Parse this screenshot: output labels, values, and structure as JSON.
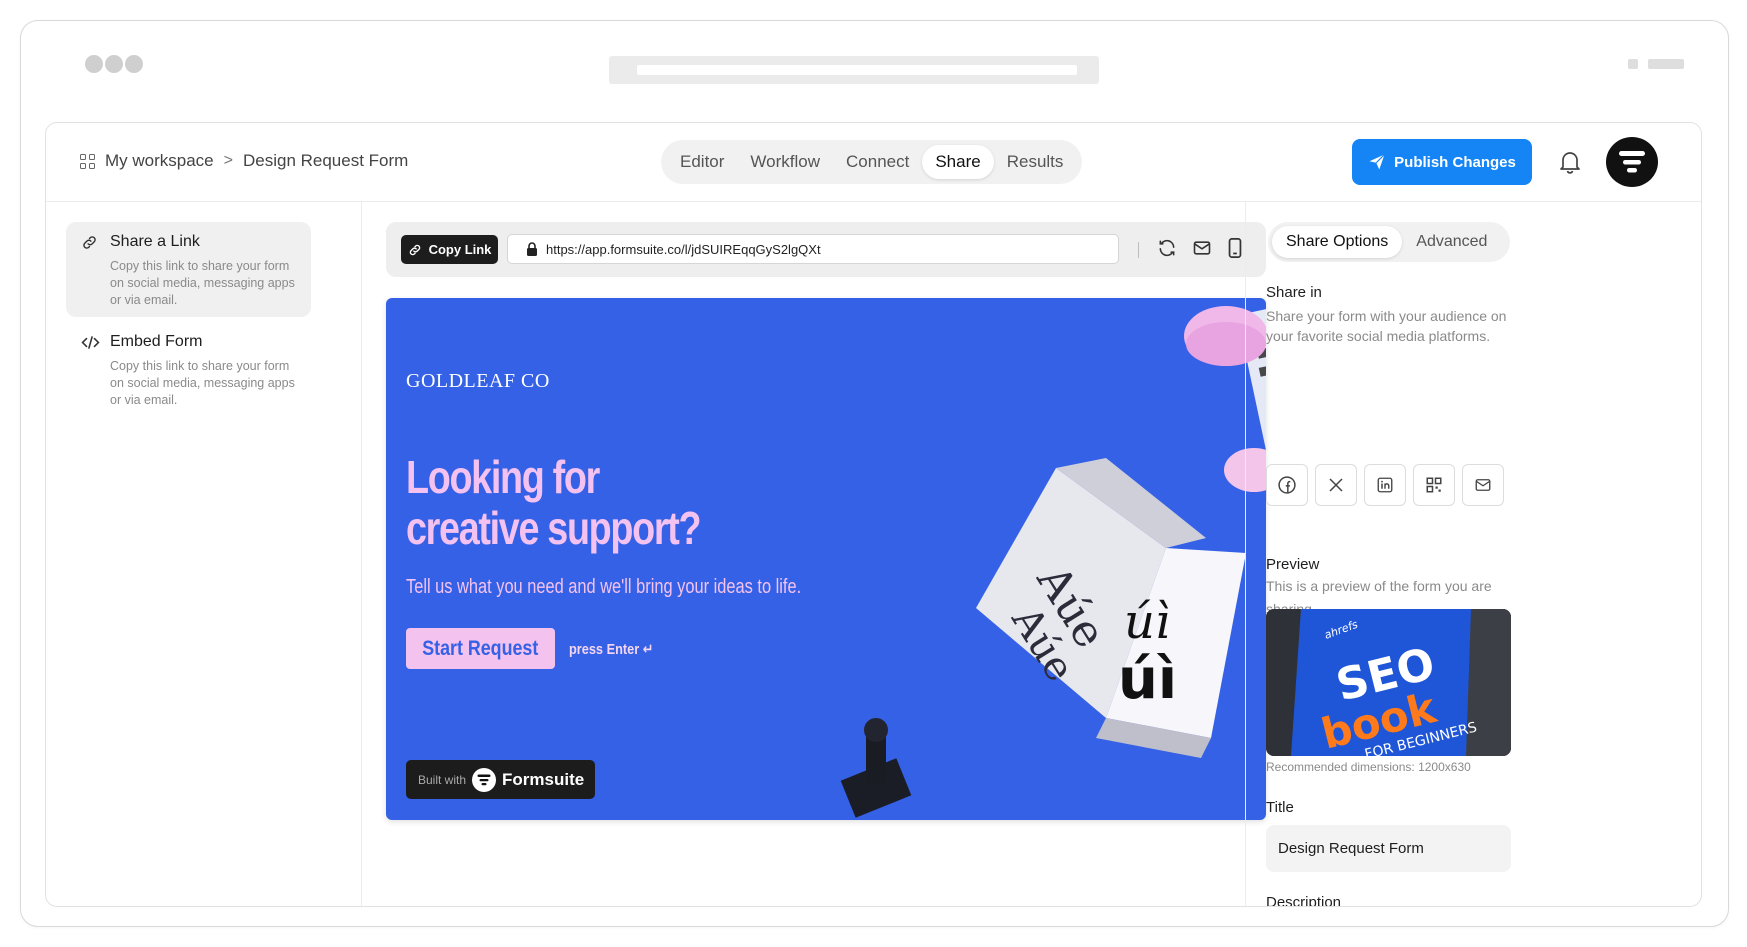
{
  "header": {
    "workspace": "My workspace",
    "separator": ">",
    "form_name": "Design Request Form",
    "tabs": [
      "Editor",
      "Workflow",
      "Connect",
      "Share",
      "Results"
    ],
    "active_tab": "Share",
    "publish_label": "Publish Changes",
    "accent_color": "#1585f5"
  },
  "left_panel": {
    "items": [
      {
        "title": "Share a Link",
        "desc": "Copy this link to share your form on social media, messaging apps or via email.",
        "icon": "link-icon"
      },
      {
        "title": "Embed Form",
        "desc": "Copy this link to share your form on social media, messaging apps or via email.",
        "icon": "code-icon"
      }
    ]
  },
  "toolbar": {
    "copy_label": "Copy Link",
    "url": "https://app.formsuite.co/l/jdSUIREqqGyS2lgQXt"
  },
  "form_preview": {
    "brand": "GOLDLEAF CO",
    "headline": "Looking for creative support?",
    "subline": "Tell us what you need and we'll bring your ideas to life.",
    "cta": "Start Request",
    "hint": "press Enter ↵",
    "built_with": "Built with",
    "built_brand": "Formsuite",
    "background_color": "#3561e6",
    "text_color": "#f4c2f0"
  },
  "right_panel": {
    "tabs": [
      "Share Options",
      "Advanced"
    ],
    "active_tab": "Share Options",
    "share_in_title": "Share in",
    "share_in_desc": "Share your form with your audience on your favorite social media platforms.",
    "social_icons": [
      "facebook-icon",
      "x-icon",
      "linkedin-icon",
      "qr-code-icon",
      "mail-icon"
    ],
    "preview_title": "Preview",
    "preview_desc": "This is a preview of the form you are sharing.",
    "preview_image_text": {
      "brand": "ahrefs",
      "line1": "SEO",
      "line2": "book",
      "line3": "FOR BEGINNERS"
    },
    "dims": "Recommended dimensions: 1200x630",
    "title_label": "Title",
    "title_value": "Design Request Form",
    "description_label": "Description"
  }
}
